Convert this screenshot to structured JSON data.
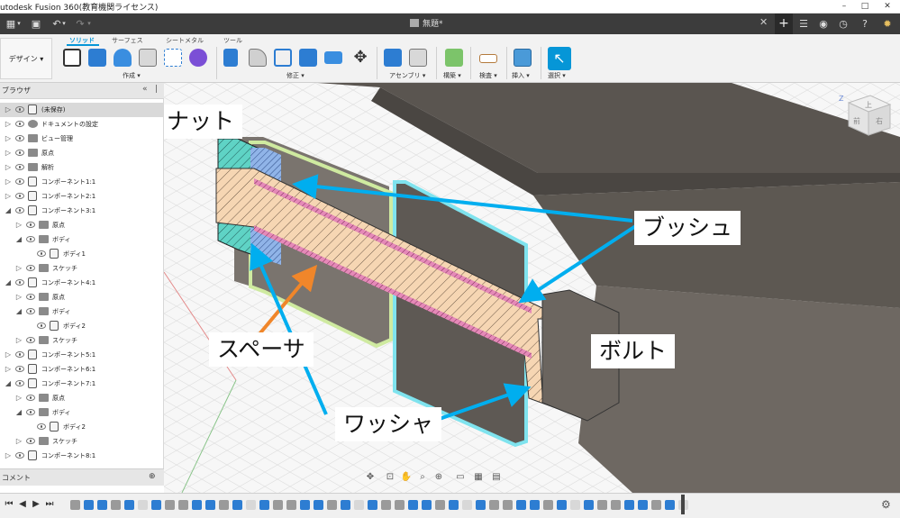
{
  "window": {
    "title": "utodesk Fusion 360(教育機関ライセンス)",
    "minimize": "–",
    "maximize": "□",
    "close": "✕"
  },
  "quick_access": {
    "document_title": "無題*",
    "close_tab": "✕",
    "new_tab": "+"
  },
  "ribbon": {
    "workspace": "デザイン ▾",
    "tabs": [
      "ソリッド",
      "サーフェス",
      "シートメタル",
      "ツール"
    ],
    "active_tab": "ソリッド",
    "groups": [
      "作成 ▾",
      "修正 ▾",
      "アセンブリ ▾",
      "構築 ▾",
      "検査 ▾",
      "挿入 ▾",
      "選択 ▾"
    ]
  },
  "browser": {
    "title": "ブラウザ",
    "rows": [
      {
        "label": "(未保存)",
        "selected": true
      },
      {
        "label": "ドキュメントの設定"
      },
      {
        "label": "ビュー管理"
      },
      {
        "label": "原点"
      },
      {
        "label": "解析"
      },
      {
        "label": "コンポーネント1:1"
      },
      {
        "label": "コンポーネント2:1"
      },
      {
        "label": "コンポーネント3:1"
      },
      {
        "label": "原点"
      },
      {
        "label": "ボディ"
      },
      {
        "label": "ボディ1"
      },
      {
        "label": "スケッチ"
      },
      {
        "label": "コンポーネント4:1"
      },
      {
        "label": "原点"
      },
      {
        "label": "ボディ"
      },
      {
        "label": "ボディ2"
      },
      {
        "label": "スケッチ"
      },
      {
        "label": "コンポーネント5:1"
      },
      {
        "label": "コンポーネント6:1"
      },
      {
        "label": "コンポーネント7:1"
      },
      {
        "label": "原点"
      },
      {
        "label": "ボディ"
      },
      {
        "label": "ボディ2"
      },
      {
        "label": "スケッチ"
      },
      {
        "label": "コンポーネント8:1"
      }
    ]
  },
  "comments": {
    "title": "コメント",
    "button": "⊕"
  },
  "viewcube": {
    "face_top": "上",
    "face_front": "前",
    "face_right": "右",
    "axis_z": "Z"
  },
  "annotations": {
    "nut": "ナット",
    "bush": "ブッシュ",
    "spacer": "スペーサ",
    "bolt": "ボルト",
    "washer": "ワッシャ"
  },
  "colors": {
    "accent_blue": "#0696d7",
    "arrow_blue": "#00aeef",
    "arrow_orange": "#f0862a",
    "bolt_fill": "#f6d6b3",
    "body_dark": "#6e6862",
    "spacer_pink": "#e589b8",
    "nut_teal": "#5fd3c5",
    "washer_blue": "#90b4e8",
    "bush_green": "#cfeaa0",
    "bush_cyan": "#7fe3ee"
  }
}
